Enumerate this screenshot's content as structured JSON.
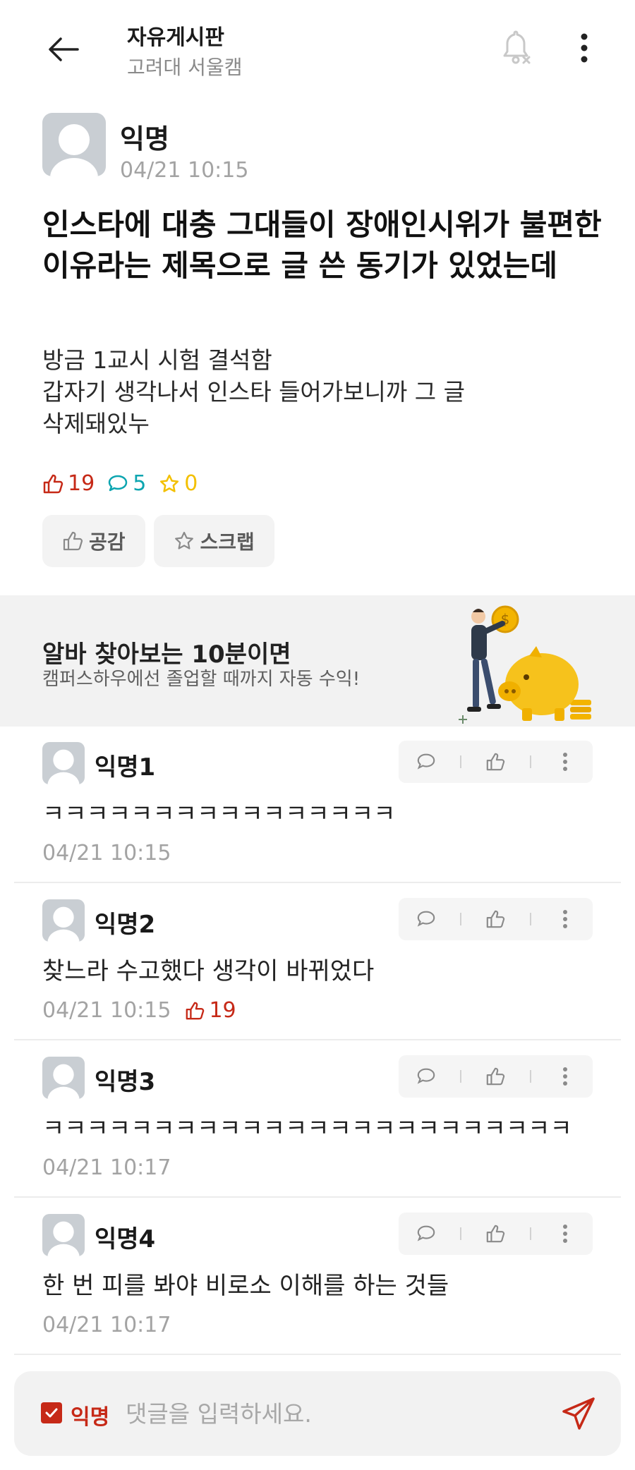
{
  "header": {
    "title": "자유게시판",
    "subtitle": "고려대 서울캠"
  },
  "post": {
    "author": "익명",
    "time": "04/21 10:15",
    "title": "인스타에 대충 그대들이 장애인시위가 불편한 이유라는 제목으로 글 쓴 동기가 있었는데",
    "body": "방금 1교시 시험 결석함\n갑자기 생각나서 인스타 들어가보니까 그 글\n삭제돼있누",
    "likes": "19",
    "comments": "5",
    "scraps": "0",
    "actions": {
      "like_label": "공감",
      "scrap_label": "스크랩"
    }
  },
  "ad": {
    "title": "알바 찾아보는 10분이면",
    "subtitle": "캠퍼스하우에선 졸업할 때까지 자동 수익!"
  },
  "comments": [
    {
      "author": "익명1",
      "text": "ㅋㅋㅋㅋㅋㅋㅋㅋㅋㅋㅋㅋㅋㅋㅋㅋ",
      "time": "04/21 10:15",
      "likes": ""
    },
    {
      "author": "익명2",
      "text": "찾느라 수고했다 생각이 바뀌었다",
      "time": "04/21 10:15",
      "likes": "19"
    },
    {
      "author": "익명3",
      "text": "ㅋㅋㅋㅋㅋㅋㅋㅋㅋㅋㅋㅋㅋㅋㅋㅋㅋㅋㅋㅋㅋㅋㅋㅋ",
      "time": "04/21 10:17",
      "likes": ""
    },
    {
      "author": "익명4",
      "text": "한 번 피를 봐야 비로소 이해를 하는 것들",
      "time": "04/21 10:17",
      "likes": ""
    }
  ],
  "composer": {
    "anon_label": "익명",
    "anon_checked": true,
    "placeholder": "댓글을 입력하세요."
  },
  "colors": {
    "accent_red": "#c62917",
    "comment_teal": "#0ca5b0",
    "scrap_yellow": "#f3c000"
  },
  "icons": [
    "back-arrow-icon",
    "bell-off-icon",
    "more-vertical-icon",
    "thumbs-up-icon",
    "comment-bubble-icon",
    "star-icon",
    "send-icon",
    "check-icon",
    "avatar-icon"
  ]
}
